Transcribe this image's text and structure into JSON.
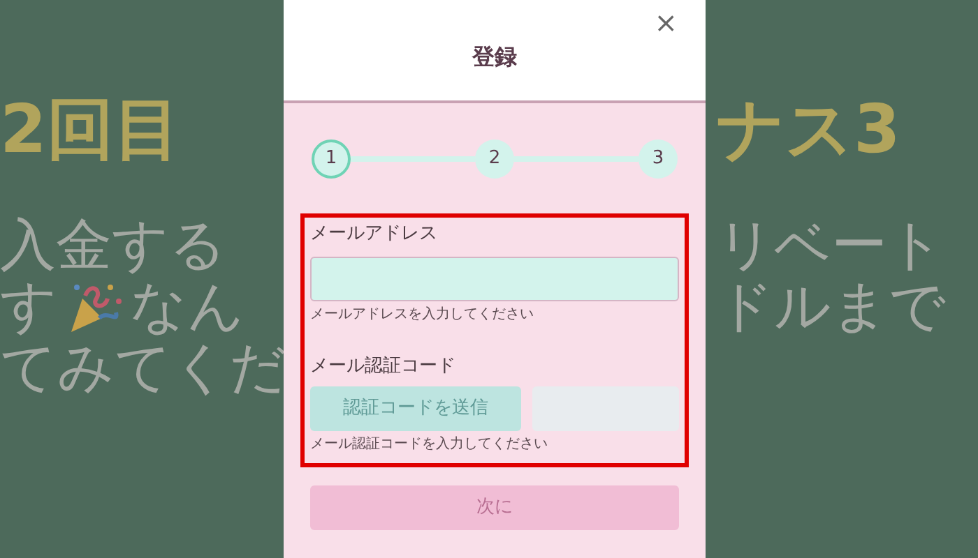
{
  "background": {
    "headline_left": "2回目",
    "headline_right": "ナス3",
    "lines_left": [
      {
        "kind": "text",
        "text": "入金する"
      },
      {
        "kind": "with_icon",
        "text": "す",
        "after": "なん"
      },
      {
        "kind": "text",
        "text": "てみてくだ"
      }
    ],
    "lines_right": [
      "リベート",
      "ドルまで"
    ]
  },
  "modal": {
    "title": "登録",
    "close": "×",
    "steps": [
      {
        "label": "1",
        "selected": true
      },
      {
        "label": "2",
        "selected": false
      },
      {
        "label": "3",
        "selected": false
      }
    ],
    "email": {
      "label": "メールアドレス",
      "hint": "メールアドレスを入力してください"
    },
    "code": {
      "label": "メール認証コード",
      "button": "認証コードを送信",
      "button_disabled": true,
      "hint": "メール認証コードを入力してください"
    },
    "next": {
      "label": "次に",
      "disabled": true
    }
  }
}
